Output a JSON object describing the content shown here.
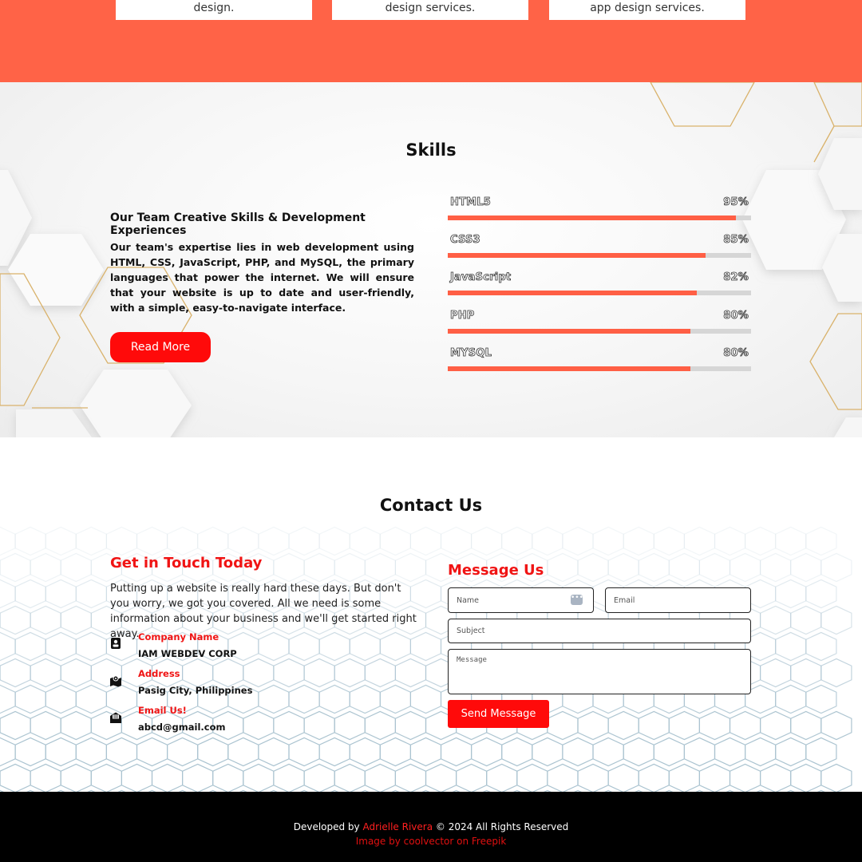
{
  "services": {
    "cards": [
      {
        "text": "design."
      },
      {
        "text": "design services."
      },
      {
        "text": "app design services."
      }
    ]
  },
  "skills": {
    "title": "Skills",
    "subtitle": "Our Team Creative Skills & Development Experiences",
    "description": "Our team's expertise lies in web development using HTML, CSS, JavaScript, PHP, and MySQL, the primary languages that power the internet. We will ensure that your website is up to date and user-friendly, with a simple, easy-to-navigate interface.",
    "read_more": "Read More",
    "items": [
      {
        "name": "HTML5",
        "percent_label": "95%",
        "percent": 95
      },
      {
        "name": "CSS3",
        "percent_label": "85%",
        "percent": 85
      },
      {
        "name": "JavaScript",
        "percent_label": "82%",
        "percent": 82
      },
      {
        "name": "PHP",
        "percent_label": "80%",
        "percent": 80
      },
      {
        "name": "MYSQL",
        "percent_label": "80%",
        "percent": 80
      }
    ]
  },
  "contact": {
    "title": "Contact Us",
    "touch_heading": "Get in Touch Today",
    "touch_text": "Putting up a website is really hard these days. But don't you worry, we got you covered. All we need is some information about your business and we'll get started right away.",
    "info": [
      {
        "label": "Company Name",
        "value": "IAM WEBDEV CORP",
        "icon": "id-card-icon"
      },
      {
        "label": "Address",
        "value": "Pasig City, Philippines",
        "icon": "map-marker-icon"
      },
      {
        "label": "Email Us!",
        "value": "abcd@gmail.com",
        "icon": "envelope-open-icon"
      }
    ],
    "form": {
      "heading": "Message Us",
      "name_placeholder": "Name",
      "email_placeholder": "Email",
      "subject_placeholder": "Subject",
      "message_placeholder": "Message",
      "send_label": "Send Message"
    }
  },
  "footer": {
    "developed_by": "Developed by",
    "author": "Adrielle Rivera",
    "rights": "© 2024 All Rights Reserved",
    "credit": "Image by coolvector on Freepik"
  },
  "colors": {
    "accent": "#ff6347",
    "button_red": "#ff0a0a",
    "heading_red": "#f01414",
    "bar_fill": "#ff5f45",
    "bar_track": "#d6d6d6",
    "footer_bg": "#000000"
  }
}
